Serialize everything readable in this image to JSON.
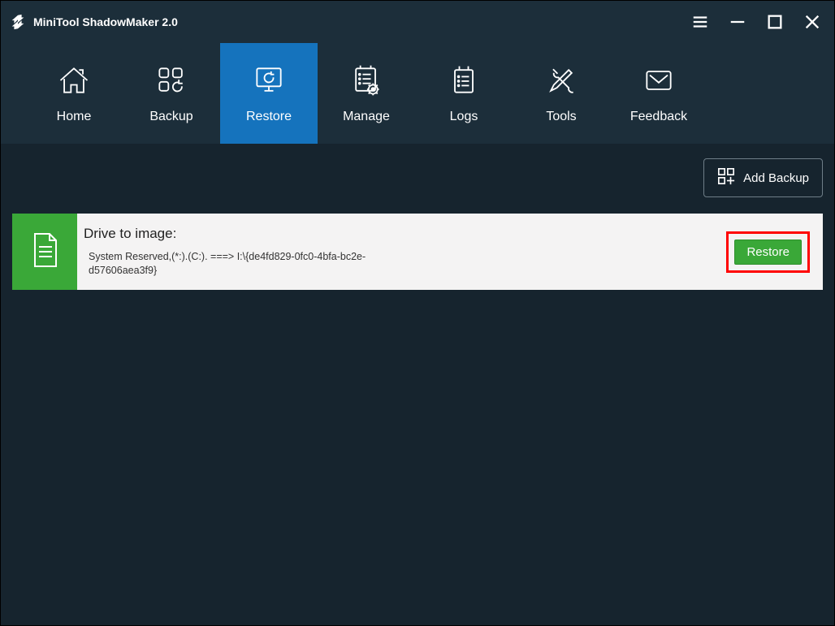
{
  "app": {
    "title": "MiniTool ShadowMaker 2.0"
  },
  "nav": {
    "tabs": [
      {
        "label": "Home",
        "icon": "home-icon",
        "active": false
      },
      {
        "label": "Backup",
        "icon": "backup-icon",
        "active": false
      },
      {
        "label": "Restore",
        "icon": "restore-icon",
        "active": true
      },
      {
        "label": "Manage",
        "icon": "manage-icon",
        "active": false
      },
      {
        "label": "Logs",
        "icon": "logs-icon",
        "active": false
      },
      {
        "label": "Tools",
        "icon": "tools-icon",
        "active": false
      },
      {
        "label": "Feedback",
        "icon": "feedback-icon",
        "active": false
      }
    ]
  },
  "toolbar": {
    "add_backup_label": "Add Backup"
  },
  "items": [
    {
      "title": "Drive to image:",
      "details": "System Reserved,(*:).(C:). ===> I:\\{de4fd829-0fc0-4bfa-bc2e-d57606aea3f9}",
      "action_label": "Restore"
    }
  ],
  "colors": {
    "accent": "#1573bd",
    "success": "#3aa838",
    "highlight": "#ff0000"
  }
}
